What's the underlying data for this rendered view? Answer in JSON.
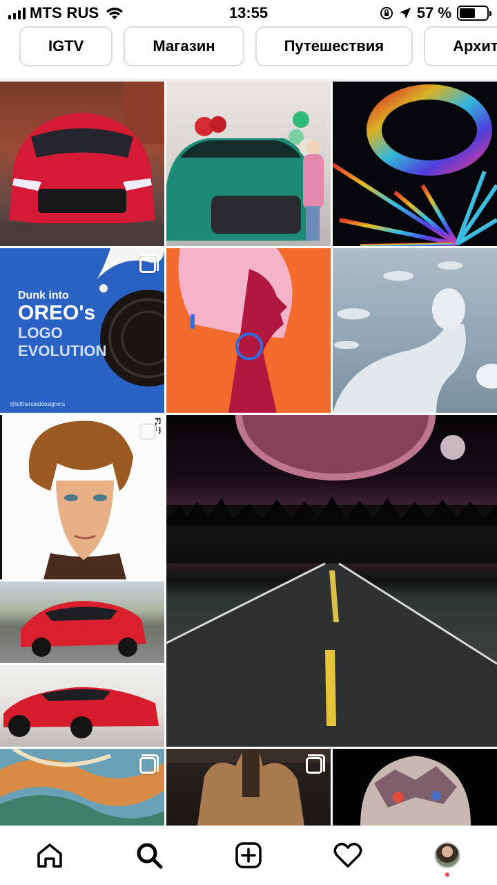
{
  "status_bar": {
    "carrier": "MTS RUS",
    "time": "13:55",
    "battery": "57 %",
    "battery_level": 0.57
  },
  "chips": [
    "IGTV",
    "Магазин",
    "Путешествия",
    "Архитектура"
  ],
  "grid": {
    "oreo_tile": {
      "line1": "Dunk into",
      "line2": "OREO's",
      "line3": "LOGO",
      "line4": "EVOLUTION",
      "handle": "@lefthandeddesigners"
    },
    "portrait_tag": "FLIP"
  },
  "nav": [
    "home-icon",
    "search-icon",
    "create-icon",
    "activity-icon",
    "profile-avatar"
  ],
  "colors": {
    "notification_dot": "#ed4956",
    "chip_border": "#dbdbdb"
  }
}
